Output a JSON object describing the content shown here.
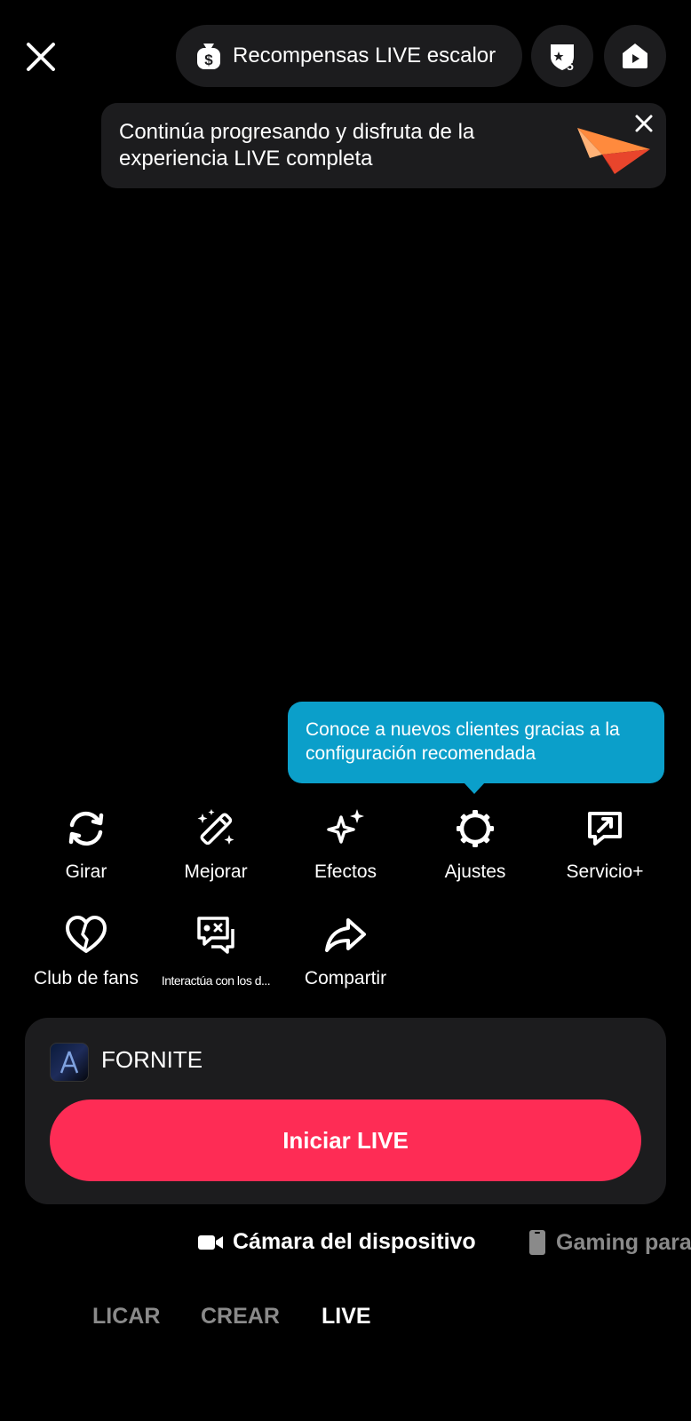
{
  "header": {
    "rewards_label": "Recompensas LIVE escalor",
    "badge_level": "5"
  },
  "progress_tooltip": {
    "text": "Continúa progresando y disfruta de la experiencia LIVE completa"
  },
  "config_tooltip": {
    "text": "Conoce a nuevos clientes gracias a la configuración recomendada"
  },
  "tools": [
    {
      "label": "Girar",
      "icon": "rotate-camera-icon"
    },
    {
      "label": "Mejorar",
      "icon": "magic-wand-icon"
    },
    {
      "label": "Efectos",
      "icon": "sparkles-icon"
    },
    {
      "label": "Ajustes",
      "icon": "settings-gear-icon"
    },
    {
      "label": "Servicio+",
      "icon": "service-plus-icon"
    },
    {
      "label": "Club de fans",
      "icon": "heart-icon"
    },
    {
      "label": "Interactúa con los d...",
      "icon": "game-chat-icon"
    },
    {
      "label": "Compartir",
      "icon": "share-arrow-icon"
    }
  ],
  "game_card": {
    "title": "FORNITE",
    "start_label": "Iniciar LIVE"
  },
  "sources": {
    "active": "Cámara del dispositivo",
    "inactive": "Gaming para"
  },
  "tabs": {
    "licar": "LICAR",
    "crear": "CREAR",
    "live": "LIVE"
  },
  "colors": {
    "background": "#000000",
    "surface": "#1c1c1e",
    "accent": "#fe2c55",
    "tooltip_blue": "#0b9fca"
  }
}
